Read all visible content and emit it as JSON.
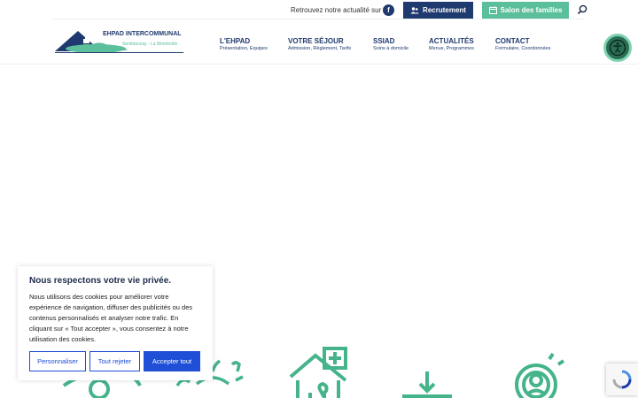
{
  "topbar": {
    "follow_text": "Retrouvez notre actualité sur",
    "facebook_glyph": "f",
    "recruitment_label": "Recrutement",
    "salon_label": "Salon des familles"
  },
  "logo": {
    "title": "EHPAD INTERCOMMUNAL",
    "subtitle": "Semblancay - La Membrolle"
  },
  "nav": [
    {
      "label": "L'EHPAD",
      "sub": "Présentation, Equipes"
    },
    {
      "label": "VOTRE SÉJOUR",
      "sub": "Admission, Règlement, Tarifs"
    },
    {
      "label": "SSIAD",
      "sub": "Soins à domicile"
    },
    {
      "label": "ACTUALITÉS",
      "sub": "Menus, Programmes"
    },
    {
      "label": "CONTACT",
      "sub": "Formulaire, Coordonnées"
    }
  ],
  "cookie": {
    "title": "Nous respectons votre vie privée.",
    "body": "Nous utilisons des cookies pour améliorer votre expérience de navigation, diffuser des publicités ou des contenus personnalisés et analyser notre trafic. En cliquant sur « Tout accepter », vous consentez à notre utilisation des cookies.",
    "customize_label": "Personnaliser",
    "reject_label": "Tout rejeter",
    "accept_label": "Accepter tout"
  },
  "colors": {
    "navy": "#1f3a6e",
    "green": "#5bbf9b",
    "accent_blue": "#1e4fd6"
  },
  "icons": [
    "eye-icon",
    "apple-icon",
    "house-medical-icon",
    "arrow-down-icon",
    "person-circle-icon"
  ]
}
